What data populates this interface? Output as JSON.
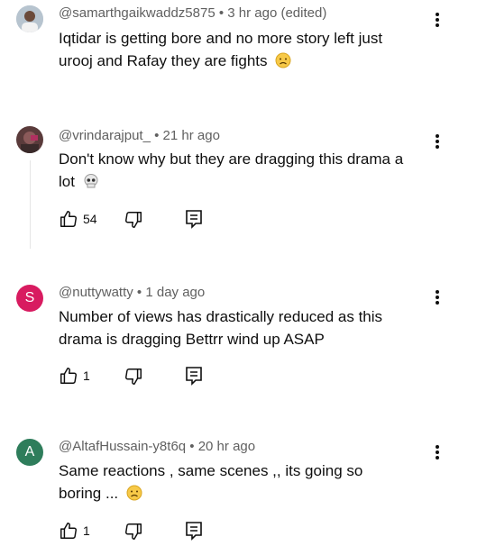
{
  "comments": [
    {
      "meta": "@samarthgaikwaddz5875 • 3 hr ago (edited)",
      "line1": "Iqtidar is getting bore and no more story left just",
      "line2": "urooj and Rafay they are fights",
      "emoji": "sad-face-emoji"
    },
    {
      "meta": "@vrindarajput_ • 21 hr ago",
      "line1": "Don't know why but they are dragging this drama a",
      "line2": "lot",
      "emoji": "skull-emoji",
      "likes": "54"
    },
    {
      "meta": "@nuttywatty • 1 day ago",
      "avatar_letter": "S",
      "avatar_color": "#d81b60",
      "line1": "Number of views has drastically reduced as this",
      "line2": "drama is dragging Bettrr wind up ASAP",
      "likes": "1"
    },
    {
      "meta": "@AltafHussain-y8t6q • 20 hr ago",
      "avatar_letter": "A",
      "avatar_color": "#2e7d5b",
      "line1": "Same reactions , same scenes ,, its going so",
      "line2": "boring ...",
      "emoji": "sad-face-emoji",
      "likes": "1"
    }
  ],
  "icons": {
    "like": "thumbs-up-icon",
    "dislike": "thumbs-down-icon",
    "reply": "reply-icon",
    "more": "more-vert-icon"
  }
}
